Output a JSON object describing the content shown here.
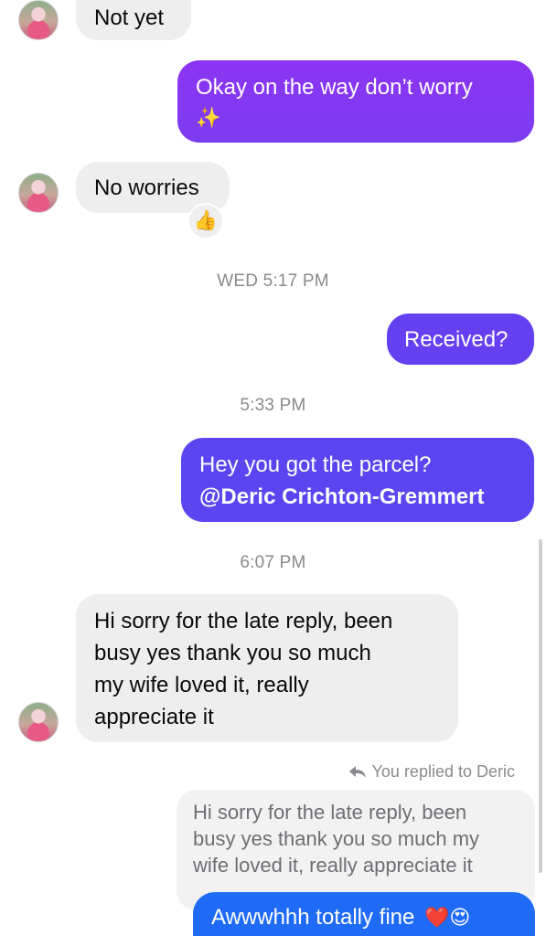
{
  "messages": {
    "m1": "Not yet",
    "m2_line1": "Okay on the way don’t worry",
    "m2_emoji": "✨",
    "m3": "No worries",
    "m3_reaction": "👍",
    "m4": "Received?",
    "m5_line1": "Hey you got the parcel?",
    "m5_line2": "@Deric Crichton-Gremmert",
    "m6_line1": "Hi sorry for the late reply, been",
    "m6_line2": "busy yes thank you so much",
    "m6_line3": "my wife loved it, really",
    "m6_line4": "appreciate it",
    "reply_label": "You replied to Deric",
    "quote_line1": "Hi sorry for the late reply, been",
    "quote_line2": "busy yes thank you so much my",
    "quote_line3": "wife loved it, really appreciate it",
    "m7": "Awwwhhh totally fine",
    "m7_emojis": "❤️😍"
  },
  "timestamps": {
    "t1": "WED 5:17 PM",
    "t2": "5:33 PM",
    "t3": "6:07 PM"
  },
  "icons": {
    "reply": "reply-arrow-icon",
    "avatar": "contact-avatar"
  }
}
